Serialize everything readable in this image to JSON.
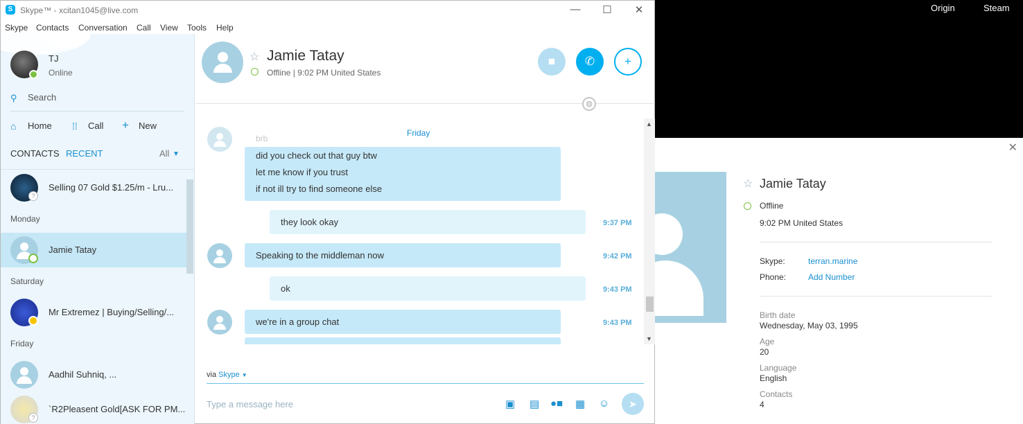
{
  "window": {
    "title": "Skype™ - xcitan1045@live.com",
    "minimize": "—",
    "maximize": "☐",
    "close": "✕"
  },
  "menu": [
    "Skype",
    "Contacts",
    "Conversation",
    "Call",
    "View",
    "Tools",
    "Help"
  ],
  "desktop": {
    "taskbar_items": [
      "Origin",
      "Steam"
    ]
  },
  "me": {
    "name": "TJ",
    "status": "Online"
  },
  "sidebar": {
    "search_label": "Search",
    "nav": {
      "home": "Home",
      "call": "Call",
      "new": "New"
    },
    "tabs": {
      "contacts": "CONTACTS",
      "recent": "RECENT",
      "filter": "All"
    },
    "groups": {
      "monday": "Monday",
      "saturday": "Saturday",
      "friday": "Friday"
    },
    "contacts": [
      {
        "name": "Selling 07 Gold $1.25/m - Lru..."
      },
      {
        "name": "Jamie Tatay"
      },
      {
        "name": "Mr Extremez | Buying/Selling/..."
      },
      {
        "name": "Aadhil Suhniq, ..."
      },
      {
        "name": "`R2Pleasent Gold[ASK FOR PM..."
      }
    ]
  },
  "conversation": {
    "contact_name": "Jamie Tatay",
    "status": "Offline",
    "local_time": "9:02 PM United States",
    "day_label": "Friday",
    "faded_text": "brb",
    "messages": [
      {
        "lines": [
          "did you check out that guy btw",
          "let me know if you trust",
          "if not ill try to find someone else"
        ],
        "time": ""
      },
      {
        "lines": [
          "they look okay"
        ],
        "time": "9:37 PM",
        "mine": true
      },
      {
        "lines": [
          "Speaking to the middleman now"
        ],
        "time": "9:42 PM"
      },
      {
        "lines": [
          "ok"
        ],
        "time": "9:43 PM",
        "mine": true
      },
      {
        "lines": [
          "we're in a group chat"
        ],
        "time": "9:43 PM"
      }
    ],
    "via_prefix": "via",
    "via_service": "Skype",
    "composer_placeholder": "Type a message here"
  },
  "profile": {
    "name": "Jamie Tatay",
    "status": "Offline",
    "local_time": "9:02 PM United States",
    "skype_label": "Skype:",
    "skype_id": "terran.marine",
    "phone_label": "Phone:",
    "phone_action": "Add Number",
    "birth_label": "Birth date",
    "birth_value": "Wednesday, May 03, 1995",
    "age_label": "Age",
    "age_value": "20",
    "language_label": "Language",
    "language_value": "English",
    "contacts_label": "Contacts",
    "contacts_value": "4"
  },
  "colors": {
    "accent": "#00aff0",
    "sidebar_bg": "#ecf6fc",
    "bubble": "#c6e9f9",
    "online": "#7ac143",
    "away": "#f5c400"
  }
}
